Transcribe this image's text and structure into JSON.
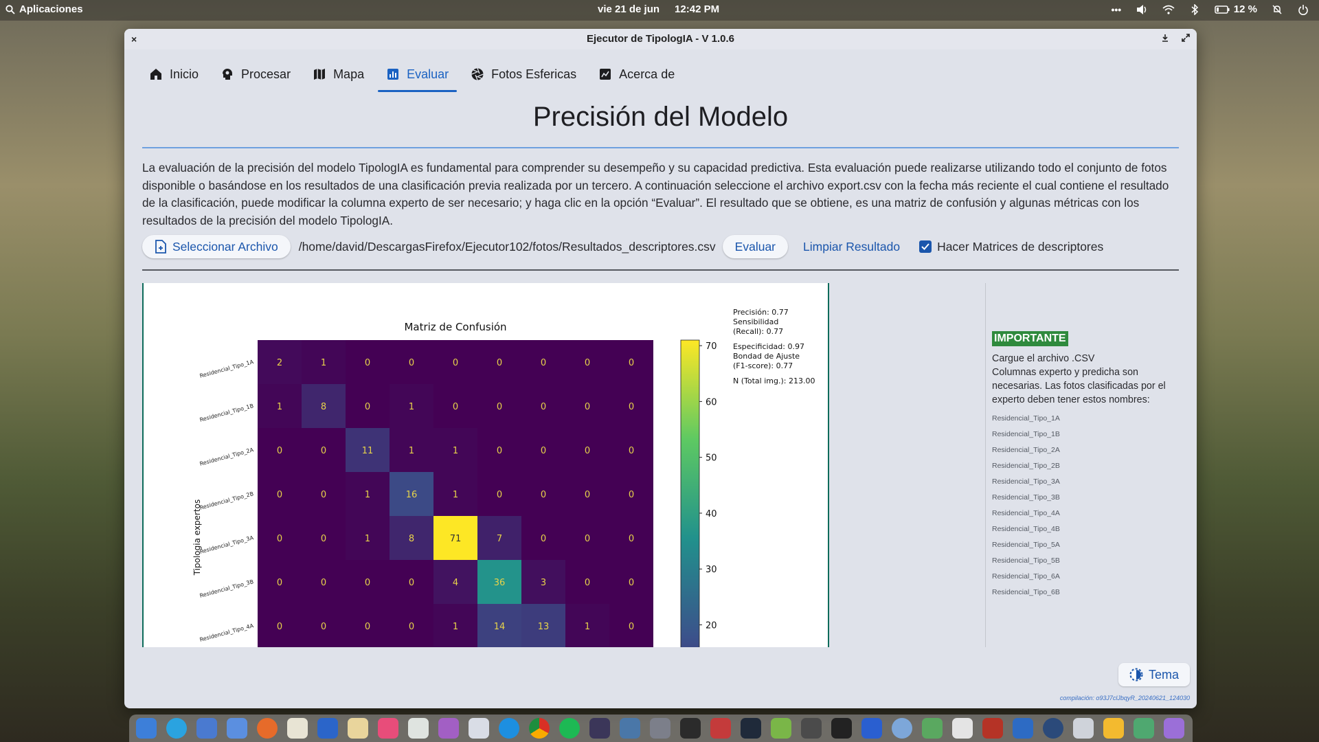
{
  "topbar": {
    "apps_label": "Aplicaciones",
    "date": "vie 21 de jun",
    "time": "12:42 PM",
    "battery": "12 %"
  },
  "window": {
    "title": "Ejecutor de TipologIA - V 1.0.6",
    "close": "×"
  },
  "tabs": [
    {
      "label": "Inicio",
      "icon": "home-icon"
    },
    {
      "label": "Procesar",
      "icon": "brain-icon"
    },
    {
      "label": "Mapa",
      "icon": "map-icon"
    },
    {
      "label": "Evaluar",
      "icon": "chart-icon",
      "active": true
    },
    {
      "label": "Fotos Esfericas",
      "icon": "aperture-icon"
    },
    {
      "label": "Acerca de",
      "icon": "info-icon"
    }
  ],
  "page": {
    "title": "Precisión del Modelo",
    "intro": "La evaluación de la precisión del modelo TipologIA es fundamental para comprender su desempeño y su capacidad predictiva. Esta evaluación puede realizarse utilizando todo el conjunto de fotos disponible o basándose en los resultados de una clasificación previa realizada por un tercero. A continuación seleccione el archivo export.csv con la fecha más reciente el cual contiene el resultado de la  clasificación, puede modificar la columna experto de ser necesario; y haga clic en la opción “Evaluar”. El resultado que se obtiene, es una matriz de confusión y algunas métricas con los resultados de la precisión del modelo TipologIA."
  },
  "actions": {
    "select_file": "Seleccionar Archivo",
    "file_path": "/home/david/DescargasFirefox/Ejecutor102/fotos/Resultados_descriptores.csv",
    "evaluate": "Evaluar",
    "clear": "Limpiar Resultado",
    "descriptor_matrices": "Hacer Matrices de descriptores",
    "descriptor_matrices_checked": true
  },
  "chart_data": {
    "type": "heatmap",
    "title": "Matriz de Confusión",
    "ylabel": "Tipologia expertos",
    "rows": [
      "Residencial_Tipo_1A",
      "Residencial_Tipo_1B",
      "Residencial_Tipo_2A",
      "Residencial_Tipo_2B",
      "Residencial_Tipo_3A",
      "Residencial_Tipo_3B",
      "Residencial_Tipo_4A"
    ],
    "matrix": [
      [
        2,
        1,
        0,
        0,
        0,
        0,
        0,
        0,
        0
      ],
      [
        1,
        8,
        0,
        1,
        0,
        0,
        0,
        0,
        0
      ],
      [
        0,
        0,
        11,
        1,
        1,
        0,
        0,
        0,
        0
      ],
      [
        0,
        0,
        1,
        16,
        1,
        0,
        0,
        0,
        0
      ],
      [
        0,
        0,
        1,
        8,
        71,
        7,
        0,
        0,
        0
      ],
      [
        0,
        0,
        0,
        0,
        4,
        36,
        3,
        0,
        0
      ],
      [
        0,
        0,
        0,
        0,
        1,
        14,
        13,
        1,
        0
      ]
    ],
    "vmin": 0,
    "vmax": 71,
    "colorbar_ticks": [
      70,
      60,
      50,
      40,
      30,
      20
    ],
    "colormap": "viridis",
    "metrics": [
      "Precisión: 0.77",
      "Sensibilidad",
      " (Recall): 0.77",
      "",
      "Especificidad: 0.97",
      "Bondad de Ajuste",
      " (F1-score): 0.77",
      "",
      "N (Total img.): 213.00"
    ]
  },
  "important": {
    "badge": "IMPORTANTE",
    "line1": "Cargue el archivo .CSV",
    "line2": "Columnas experto y predicha son necesarias. Las fotos clasificadas por el experto deben tener estos nombres:",
    "names": [
      "Residencial_Tipo_1A",
      "Residencial_Tipo_1B",
      "Residencial_Tipo_2A",
      "Residencial_Tipo_2B",
      "Residencial_Tipo_3A",
      "Residencial_Tipo_3B",
      "Residencial_Tipo_4A",
      "Residencial_Tipo_4B",
      "Residencial_Tipo_5A",
      "Residencial_Tipo_5B",
      "Residencial_Tipo_6A",
      "Residencial_Tipo_6B"
    ]
  },
  "footer": {
    "theme_button": "Tema",
    "build": "compilación: o93J7clJbqyR_20240621_124030"
  },
  "colors": {
    "accent": "#1b62c2",
    "important_green": "#2f8a3d"
  }
}
